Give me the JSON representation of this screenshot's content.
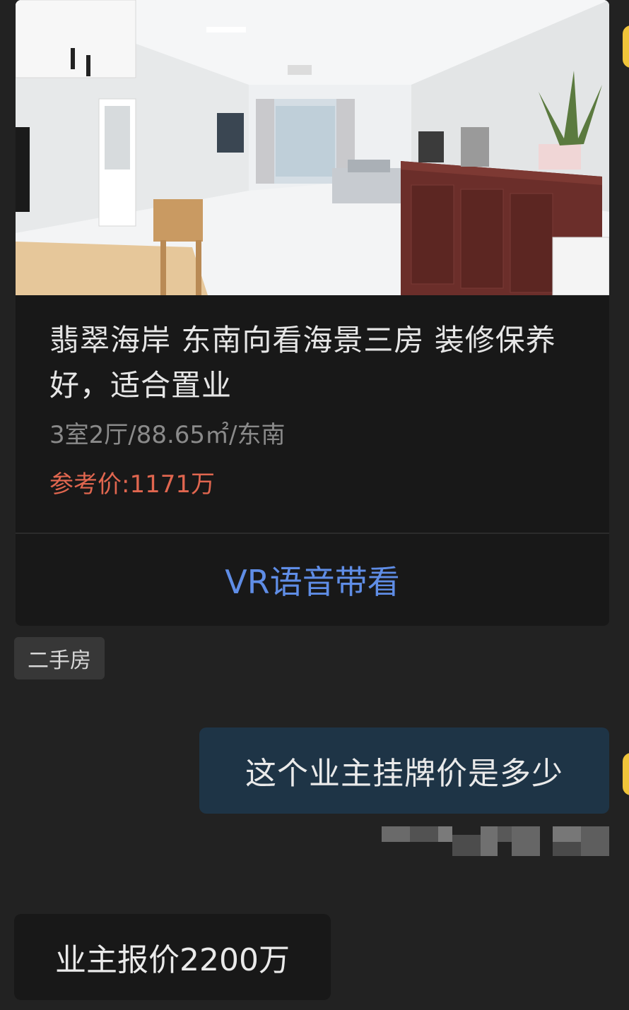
{
  "listing": {
    "title": "翡翠海岸 东南向看海景三房 装修保养好，适合置业",
    "specs": "3室2厅/88.65㎡/东南",
    "price": "参考价:1171万",
    "vr_button_label": "VR语音带看",
    "tag": "二手房"
  },
  "messages": {
    "user": "这个业主挂牌价是多少",
    "agent": "业主报价2200万"
  },
  "colors": {
    "page_bg": "#222222",
    "card_bg": "#181818",
    "price": "#e0664f",
    "vr_link": "#5f8de6",
    "user_bubble": "#1e3446"
  }
}
